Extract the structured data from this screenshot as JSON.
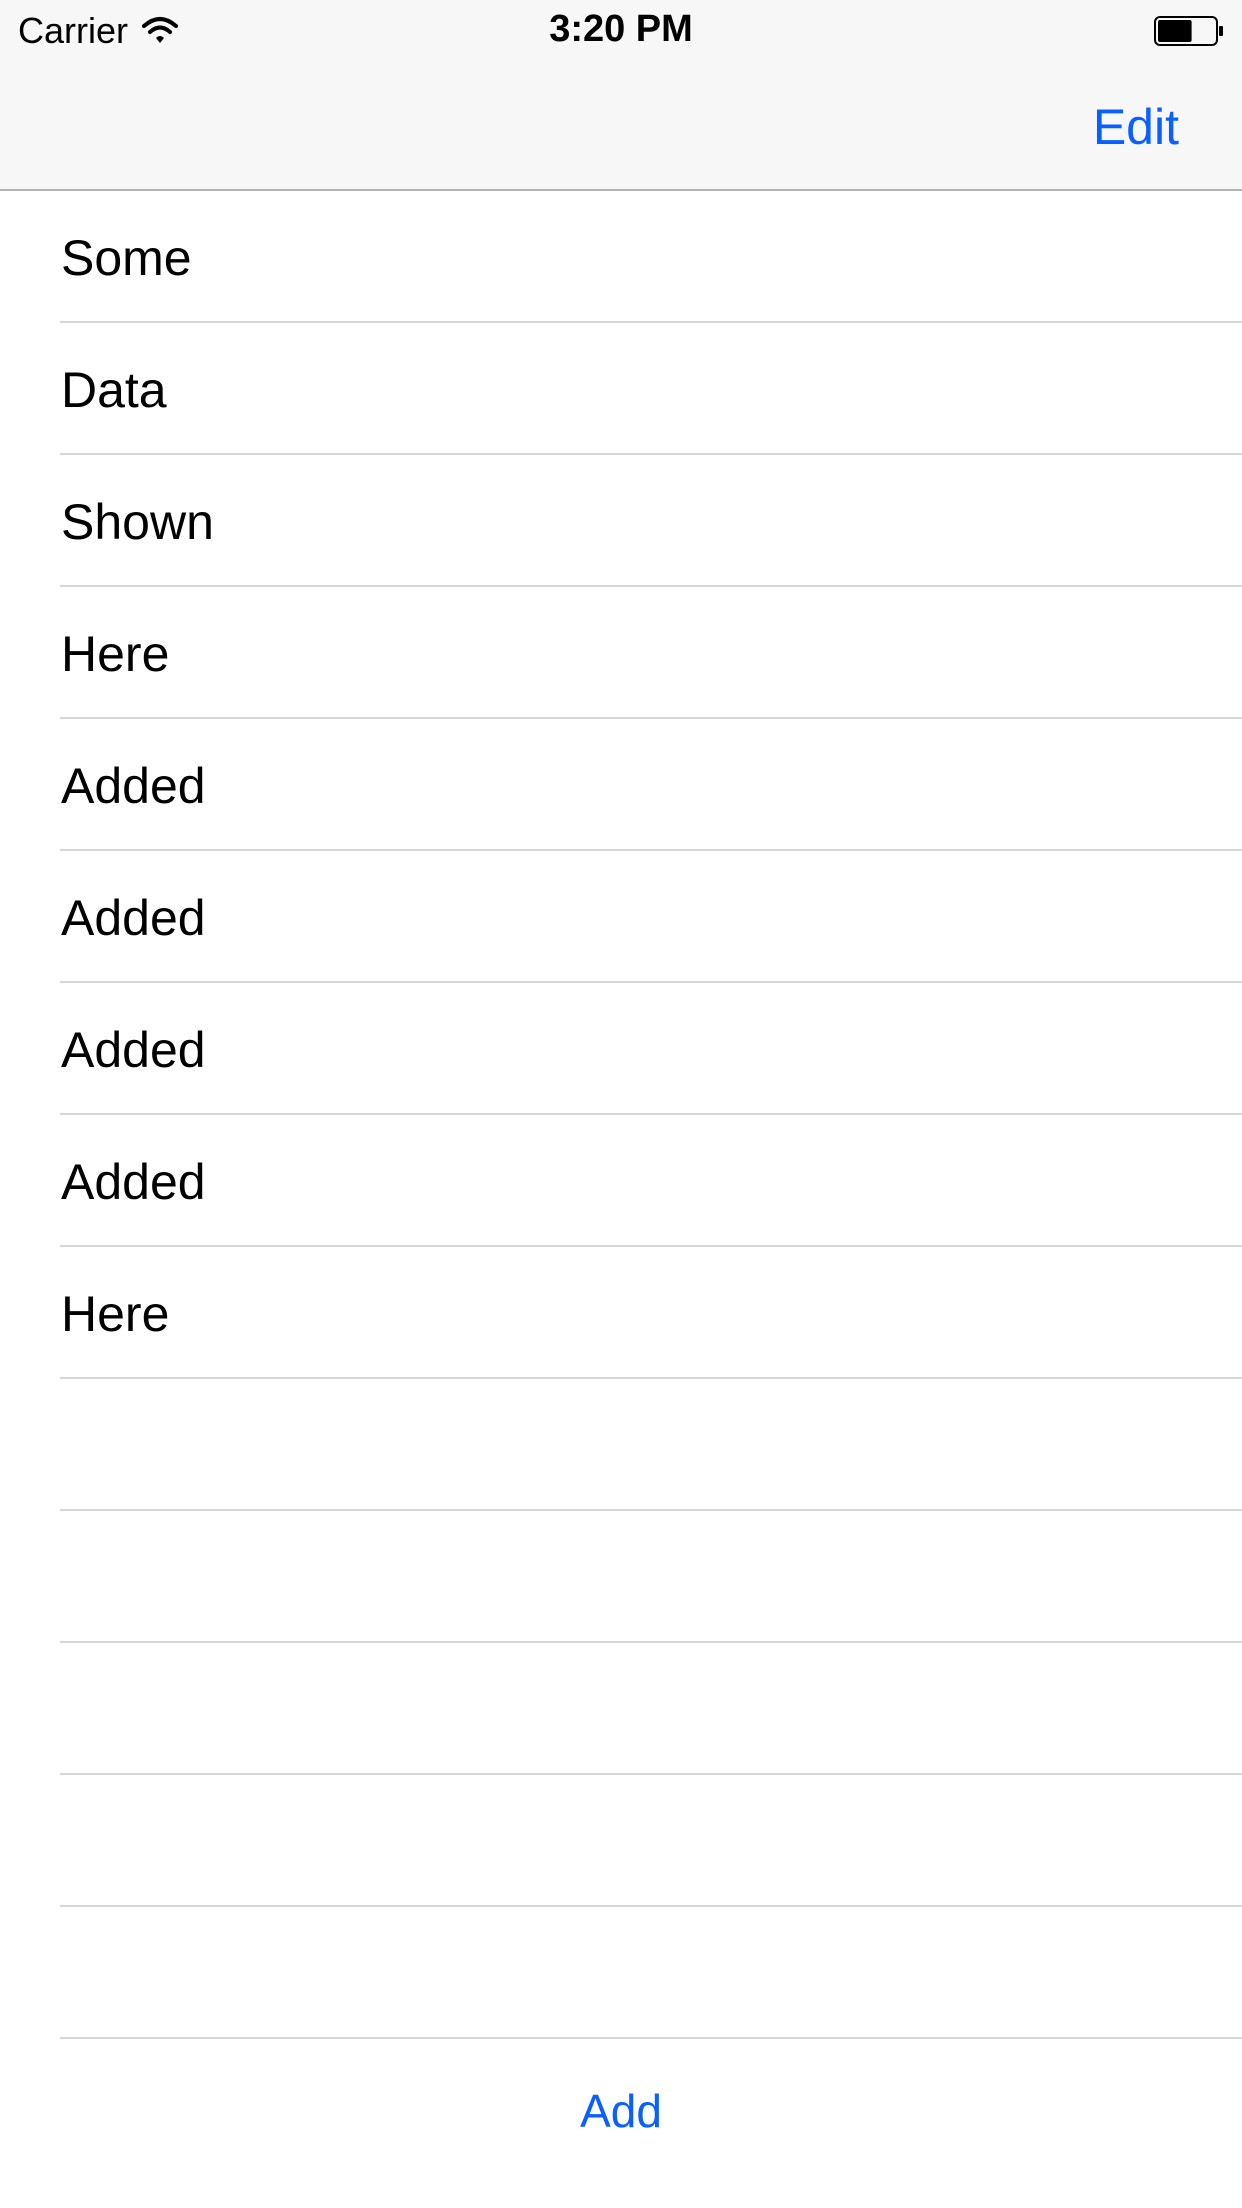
{
  "status_bar": {
    "carrier": "Carrier",
    "time": "3:20 PM",
    "wifi_icon": "wifi-icon",
    "battery_icon": "battery-icon",
    "battery_level": 0.6
  },
  "nav": {
    "edit_label": "Edit"
  },
  "rows": [
    {
      "label": "Some"
    },
    {
      "label": "Data"
    },
    {
      "label": "Shown"
    },
    {
      "label": "Here"
    },
    {
      "label": "Added"
    },
    {
      "label": "Added"
    },
    {
      "label": "Added"
    },
    {
      "label": "Added"
    },
    {
      "label": "Here"
    },
    {
      "label": ""
    },
    {
      "label": ""
    },
    {
      "label": ""
    },
    {
      "label": ""
    },
    {
      "label": ""
    }
  ],
  "toolbar": {
    "add_label": "Add"
  },
  "colors": {
    "accent": "#0a60fe",
    "bar_background": "#f7f7f7",
    "separator": "#d6d6d6"
  }
}
